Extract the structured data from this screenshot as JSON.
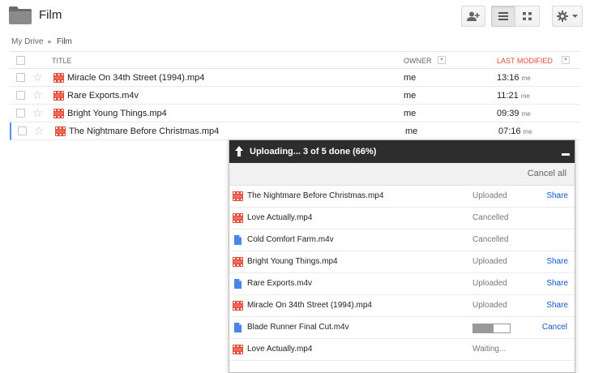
{
  "header": {
    "title": "Film",
    "folder_icon": "folder-icon",
    "buttons": [
      "add-person-icon",
      "list-view-icon",
      "grid-view-icon",
      "gear-icon"
    ]
  },
  "breadcrumb": {
    "root": "My Drive",
    "current": "Film"
  },
  "table": {
    "columns": {
      "title": "TITLE",
      "owner": "OWNER",
      "modified": "LAST MODIFIED"
    },
    "rows": [
      {
        "name": "Miracle On 34th Street (1994).mp4",
        "owner": "me",
        "time": "13:16",
        "unit": "me"
      },
      {
        "name": "Rare Exports.m4v",
        "owner": "me",
        "time": "11:21",
        "unit": "me"
      },
      {
        "name": "Bright Young Things.mp4",
        "owner": "me",
        "time": "09:39",
        "unit": "me"
      },
      {
        "name": "The Nightmare Before Christmas.mp4",
        "owner": "me",
        "time": "07:16",
        "unit": "me"
      }
    ]
  },
  "upload": {
    "title": "Uploading... 3 of 5 done (66%)",
    "cancel_all": "Cancel all",
    "items": [
      {
        "name": "The Nightmare Before Christmas.mp4",
        "type": "video",
        "status": "Uploaded",
        "action": "Share"
      },
      {
        "name": "Love Actually.mp4",
        "type": "video",
        "status": "Cancelled",
        "action": ""
      },
      {
        "name": "Cold Comfort Farm.m4v",
        "type": "doc",
        "status": "Cancelled",
        "action": ""
      },
      {
        "name": "Bright Young Things.mp4",
        "type": "video",
        "status": "Uploaded",
        "action": "Share"
      },
      {
        "name": "Rare Exports.m4v",
        "type": "doc",
        "status": "Uploaded",
        "action": "Share"
      },
      {
        "name": "Miracle On 34th Street (1994).mp4",
        "type": "video",
        "status": "Uploaded",
        "action": "Share"
      },
      {
        "name": "Blade Runner Final Cut.m4v",
        "type": "doc",
        "status": "",
        "progress": 0.55,
        "action": "Cancel"
      },
      {
        "name": "Love Actually.mp4",
        "type": "video",
        "status": "Waiting...",
        "action": ""
      }
    ]
  },
  "colors": {
    "accent_red": "#dd4b39",
    "link_blue": "#1155cc",
    "panel_header": "#2d2d2d"
  }
}
